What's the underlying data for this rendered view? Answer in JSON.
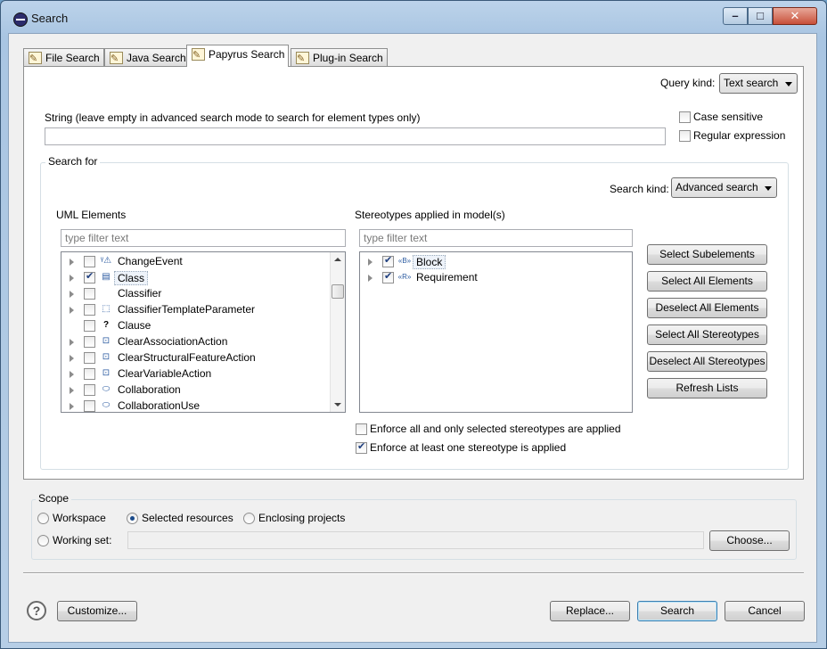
{
  "window": {
    "title": "Search"
  },
  "tabs": [
    {
      "label": "File Search",
      "icon": "file-search-icon"
    },
    {
      "label": "Java Search",
      "icon": "java-search-icon"
    },
    {
      "label": "Papyrus Search",
      "icon": "papyrus-search-icon",
      "active": true
    },
    {
      "label": "Plug-in Search",
      "icon": "plugin-search-icon"
    }
  ],
  "query": {
    "kind_label": "Query kind:",
    "kind_value": "Text search",
    "string_label": "String (leave empty in advanced search mode to search for element types only)",
    "string_value": "",
    "case_sensitive_label": "Case sensitive",
    "case_sensitive": false,
    "regex_label": "Regular expression",
    "regex": false
  },
  "search_for": {
    "title": "Search for",
    "kind_label": "Search kind:",
    "kind_value": "Advanced search",
    "uml_label": "UML Elements",
    "uml_filter_placeholder": "type filter text",
    "uml_items": [
      {
        "label": "ChangeEvent",
        "checked": false,
        "expandable": true,
        "icon": "change-event-icon"
      },
      {
        "label": "Class",
        "checked": true,
        "expandable": true,
        "icon": "class-icon",
        "selected": true
      },
      {
        "label": "Classifier",
        "checked": false,
        "expandable": true,
        "icon": ""
      },
      {
        "label": "ClassifierTemplateParameter",
        "checked": false,
        "expandable": true,
        "icon": "template-parameter-icon"
      },
      {
        "label": "Clause",
        "checked": false,
        "expandable": false,
        "icon": "question-icon"
      },
      {
        "label": "ClearAssociationAction",
        "checked": false,
        "expandable": true,
        "icon": "clear-association-action-icon"
      },
      {
        "label": "ClearStructuralFeatureAction",
        "checked": false,
        "expandable": true,
        "icon": "clear-structural-feature-action-icon"
      },
      {
        "label": "ClearVariableAction",
        "checked": false,
        "expandable": true,
        "icon": "clear-variable-action-icon"
      },
      {
        "label": "Collaboration",
        "checked": false,
        "expandable": true,
        "icon": "collaboration-icon"
      },
      {
        "label": "CollaborationUse",
        "checked": false,
        "expandable": true,
        "icon": "collaboration-use-icon"
      }
    ],
    "stereo_label": "Stereotypes applied in model(s)",
    "stereo_filter_placeholder": "type filter text",
    "stereo_items": [
      {
        "label": "Block",
        "checked": true,
        "expandable": true,
        "icon": "block-stereotype-icon",
        "selected": true
      },
      {
        "label": "Requirement",
        "checked": true,
        "expandable": true,
        "icon": "requirement-stereotype-icon"
      }
    ],
    "buttons": {
      "select_subelements": "Select Subelements",
      "select_all_elements": "Select All Elements",
      "deselect_all_elements": "Deselect All Elements",
      "select_all_stereotypes": "Select All Stereotypes",
      "deselect_all_stereotypes": "Deselect All Stereotypes",
      "refresh_lists": "Refresh Lists"
    },
    "enforce_all_label": "Enforce all and only selected stereotypes are applied",
    "enforce_all": false,
    "enforce_one_label": "Enforce at least one stereotype is applied",
    "enforce_one": true
  },
  "scope": {
    "title": "Scope",
    "workspace_label": "Workspace",
    "selected_resources_label": "Selected resources",
    "enclosing_projects_label": "Enclosing projects",
    "working_set_label": "Working set:",
    "selected": "Selected resources",
    "working_set_value": "",
    "choose_label": "Choose..."
  },
  "footer": {
    "customize_label": "Customize...",
    "replace_label": "Replace...",
    "search_label": "Search",
    "cancel_label": "Cancel"
  }
}
